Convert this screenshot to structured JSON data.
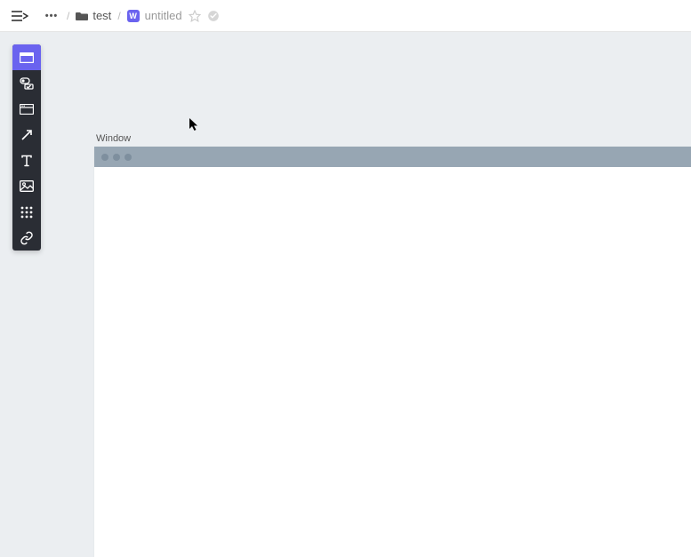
{
  "breadcrumb": {
    "ellipsis": "•••",
    "folder_name": "test",
    "doc_badge": "W",
    "doc_title": "untitled"
  },
  "toolbox": {
    "items": [
      {
        "name": "window-tool",
        "active": true
      },
      {
        "name": "controls-tool",
        "active": false
      },
      {
        "name": "browser-tool",
        "active": false
      },
      {
        "name": "arrow-tool",
        "active": false
      },
      {
        "name": "text-tool",
        "active": false
      },
      {
        "name": "image-tool",
        "active": false
      },
      {
        "name": "grid-tool",
        "active": false
      },
      {
        "name": "link-tool",
        "active": false
      }
    ]
  },
  "canvas": {
    "window_label": "Window"
  }
}
